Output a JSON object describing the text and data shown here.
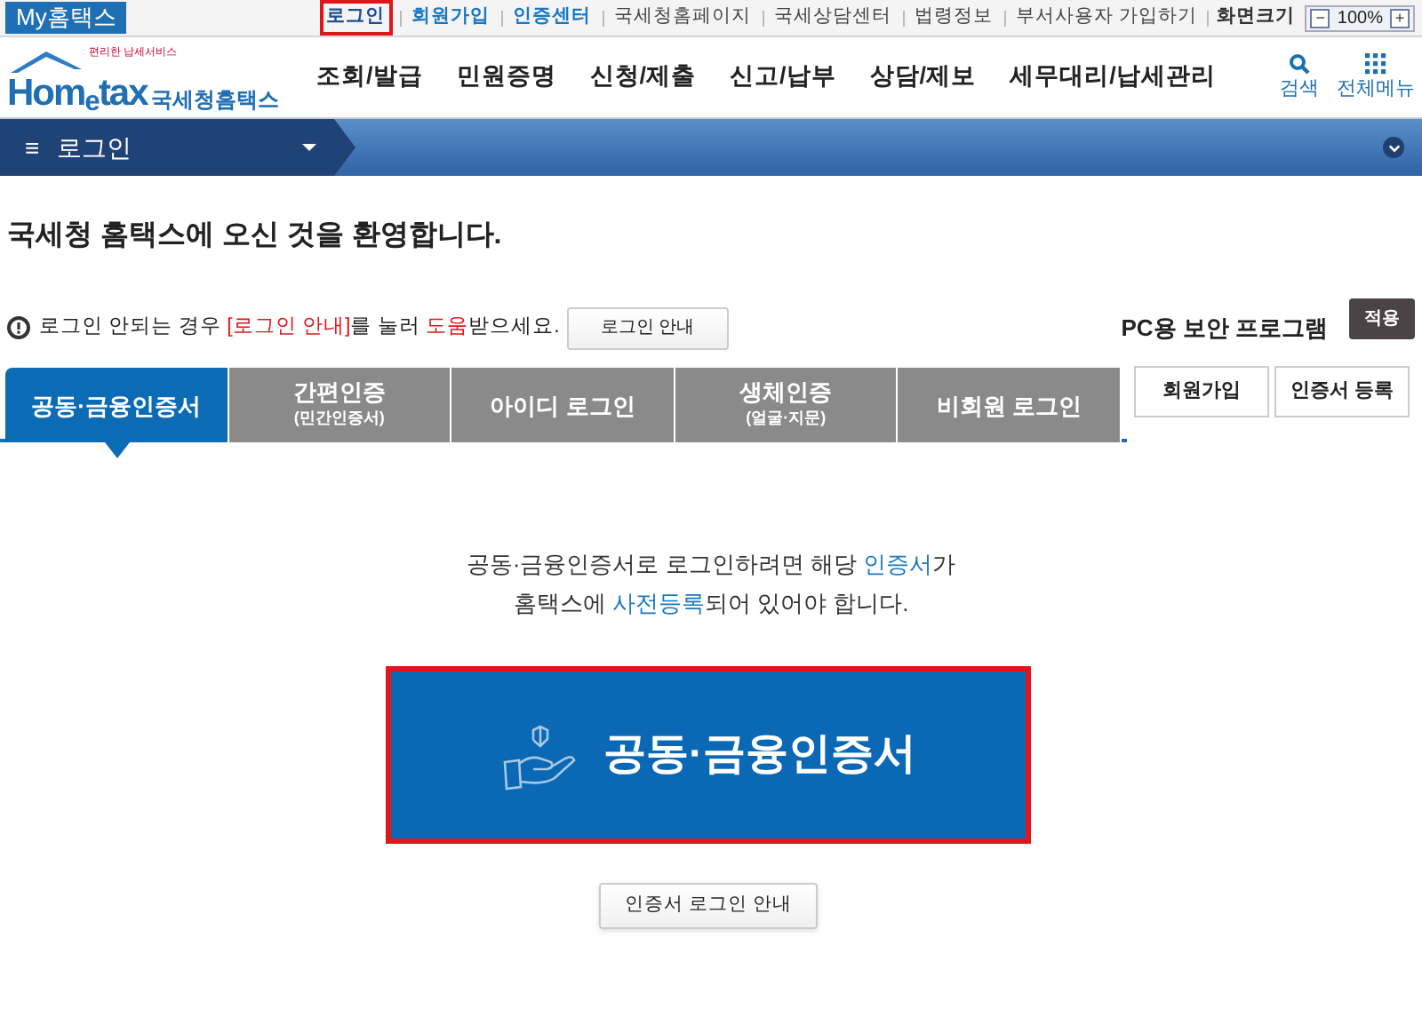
{
  "top_bar": {
    "brand": "My홈택스",
    "links": [
      {
        "label": "로그인",
        "selected": true,
        "emphasis": true
      },
      {
        "label": "회원가입",
        "selected": false,
        "emphasis": true
      },
      {
        "label": "인증센터",
        "selected": false,
        "emphasis": true
      },
      {
        "label": "국세청홈페이지",
        "selected": false,
        "emphasis": false
      },
      {
        "label": "국세상담센터",
        "selected": false,
        "emphasis": false
      },
      {
        "label": "법령정보",
        "selected": false,
        "emphasis": false
      },
      {
        "label": "부서사용자 가입하기",
        "selected": false,
        "emphasis": false
      }
    ],
    "zoom": {
      "label": "화면크기",
      "minus": "−",
      "value": "100%",
      "plus": "+"
    }
  },
  "header": {
    "logo": {
      "tagline": "편리한 납세서비스",
      "name": "Hom$_{e}$tax",
      "korean": "국세청홈택스"
    },
    "menu": [
      "조회/발급",
      "민원증명",
      "신청/제출",
      "신고/납부",
      "상담/제보",
      "세무대리/납세관리"
    ],
    "actions": [
      {
        "kind": "search",
        "label": "검색"
      },
      {
        "kind": "grid",
        "label": "전체메뉴"
      }
    ]
  },
  "breadcrumb": {
    "icon": "≡",
    "title": "로그인"
  },
  "welcome": "국세청 홈택스에 오신 것을 환영합니다.",
  "notice": {
    "segments": [
      {
        "text": "로그인 안되는 경우 ",
        "accent": false
      },
      {
        "text": "[로그인 안내]",
        "accent": true
      },
      {
        "text": "를 눌러 ",
        "accent": false
      },
      {
        "text": "도움",
        "accent": true
      },
      {
        "text": "받으세요.",
        "accent": false
      }
    ],
    "button": "로그인 안내"
  },
  "security": {
    "label": "PC용 보안 프로그램",
    "button": "적용"
  },
  "tabs": [
    {
      "label": "공동·금융인증서",
      "selected": true
    },
    {
      "label": "간편인증",
      "sublabel": "(민간인증서)",
      "selected": false
    },
    {
      "label": "아이디 로그인",
      "selected": false
    },
    {
      "label": "생체인증",
      "sublabel": "(얼굴·지문)",
      "selected": false
    },
    {
      "label": "비회원 로그인",
      "selected": false
    }
  ],
  "side_buttons": [
    "회원가입",
    "인증서 등록"
  ],
  "description": [
    [
      {
        "text": "공동·금융인증서로 로그인하려면 해당 ",
        "accent": false
      },
      {
        "text": "인증서",
        "accent": true
      },
      {
        "text": "가",
        "accent": false
      }
    ],
    [
      {
        "text": "홈택스에 ",
        "accent": false
      },
      {
        "text": "사전등록",
        "accent": true
      },
      {
        "text": "되어 있어야 합니다.",
        "accent": false
      }
    ]
  ],
  "login_button": {
    "label": "공동·금융인증서",
    "highlighted": true
  },
  "guide_button": "인증서 로그인 안내"
}
